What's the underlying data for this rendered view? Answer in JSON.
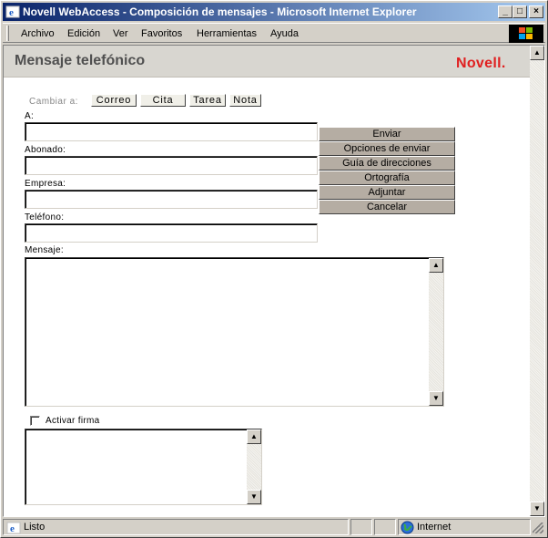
{
  "window": {
    "title": "Novell WebAccess - Composición de mensajes - Microsoft Internet Explorer",
    "controls": {
      "minimize": "_",
      "maximize": "□",
      "close": "×"
    }
  },
  "menu": [
    "Archivo",
    "Edición",
    "Ver",
    "Favoritos",
    "Herramientas",
    "Ayuda"
  ],
  "header": {
    "title": "Mensaje telefónico",
    "brand": "Novell."
  },
  "switch_to": {
    "label": "Cambiar a:",
    "options": [
      "Correo",
      "Cita",
      "Tarea",
      "Nota"
    ]
  },
  "fields": {
    "to": {
      "label": "A:",
      "value": ""
    },
    "caller": {
      "label": "Abonado:",
      "value": ""
    },
    "company": {
      "label": "Empresa:",
      "value": ""
    },
    "phone": {
      "label": "Teléfono:",
      "value": ""
    },
    "message": {
      "label": "Mensaje:",
      "value": ""
    }
  },
  "actions": [
    "Enviar",
    "Opciones de enviar",
    "Guía de direcciones",
    "Ortografía",
    "Adjuntar",
    "Cancelar"
  ],
  "signature": {
    "label": "Activar firma",
    "checked": false,
    "value": ""
  },
  "status": {
    "text": "Listo",
    "zone": "Internet"
  },
  "icons": [
    "ie-icon",
    "windows-logo-icon",
    "globe-icon",
    "scroll-up-icon",
    "scroll-down-icon",
    "checkbox-icon"
  ]
}
